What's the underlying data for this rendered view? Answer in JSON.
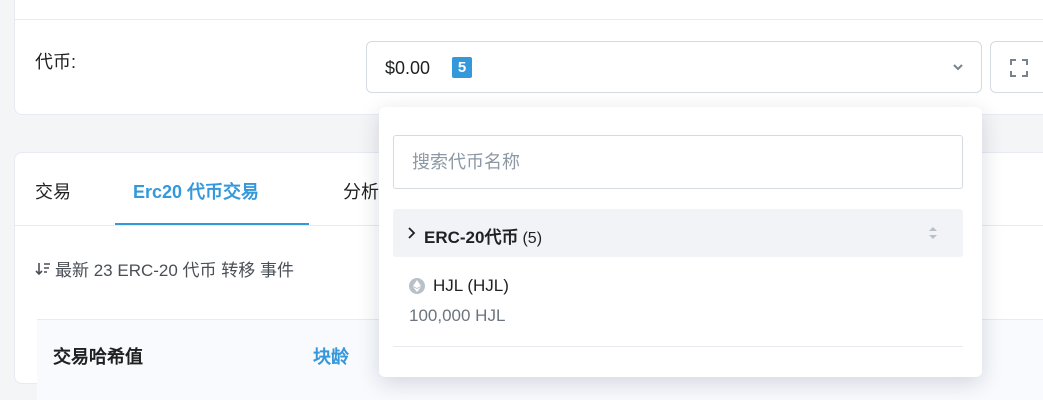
{
  "token_section": {
    "label": "代币:",
    "select_value": "$0.00",
    "token_count": "5"
  },
  "tabs": [
    {
      "label": "交易"
    },
    {
      "label": "Erc20 代币交易"
    },
    {
      "label": "分析"
    }
  ],
  "info_text": "最新 23 ERC-20 代币 转移 事件",
  "table": {
    "headers": [
      "交易哈希值",
      "块龄"
    ]
  },
  "dropdown": {
    "search_placeholder": "搜索代币名称",
    "group": {
      "name": "ERC-20代币",
      "count": "(5)"
    },
    "items": [
      {
        "name": "HJL (HJL)",
        "amount": "100,000 HJL"
      }
    ]
  },
  "colors": {
    "accent": "#3498db",
    "text": "#1e2022",
    "muted": "#6c757e",
    "border": "#e7eaf3"
  }
}
